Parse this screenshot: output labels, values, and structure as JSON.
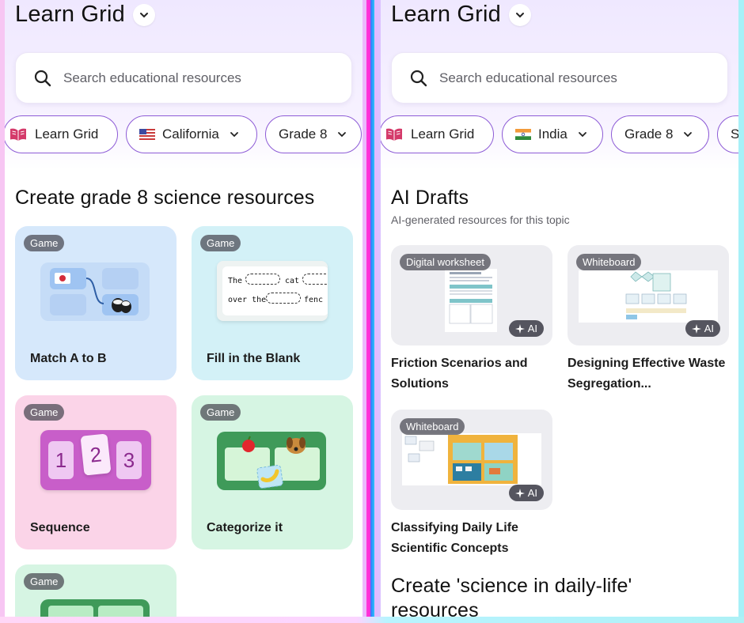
{
  "left": {
    "title": "Learn Grid",
    "search_placeholder": "Search educational resources",
    "chips": [
      "Learn Grid",
      "California",
      "Grade 8"
    ],
    "section_title": "Create grade 8 science resources",
    "cards": [
      {
        "badge": "Game",
        "label": "Match A to B",
        "bg": "#d6e8fb"
      },
      {
        "badge": "Game",
        "label": "Fill in the Blank",
        "bg": "#d3f1f7"
      },
      {
        "badge": "Game",
        "label": "Sequence",
        "bg": "#fbd4e8"
      },
      {
        "badge": "Game",
        "label": "Categorize it",
        "bg": "#d6f5e3"
      },
      {
        "badge": "Game",
        "label": "",
        "bg": "#d6f5e3"
      }
    ],
    "fill_blank": {
      "line1a": "The",
      "line1b": "cat",
      "line2a": "over the",
      "line2b": "fenc"
    },
    "sequence_digits": [
      "1",
      "2",
      "3"
    ]
  },
  "right": {
    "title": "Learn Grid",
    "search_placeholder": "Search educational resources",
    "chips": [
      "Learn Grid",
      "India",
      "Grade 8",
      "S"
    ],
    "section_title": "AI Drafts",
    "section_subtitle": "AI-generated resources for this topic",
    "drafts": [
      {
        "badge": "Digital worksheet",
        "ai": "AI",
        "title": "Friction Scenarios and Solutions"
      },
      {
        "badge": "Whiteboard",
        "ai": "AI",
        "title": "Designing Effective Waste Segregation..."
      },
      {
        "badge": "Whiteboard",
        "ai": "AI",
        "title": "Classifying Daily Life Scientific Concepts"
      }
    ],
    "bottom_title": "Create 'science in daily-life' resources"
  },
  "colors": {
    "accent": "#8d5bd6",
    "divider_pink": "#ff2bd7",
    "divider_blue": "#2f7cff"
  }
}
